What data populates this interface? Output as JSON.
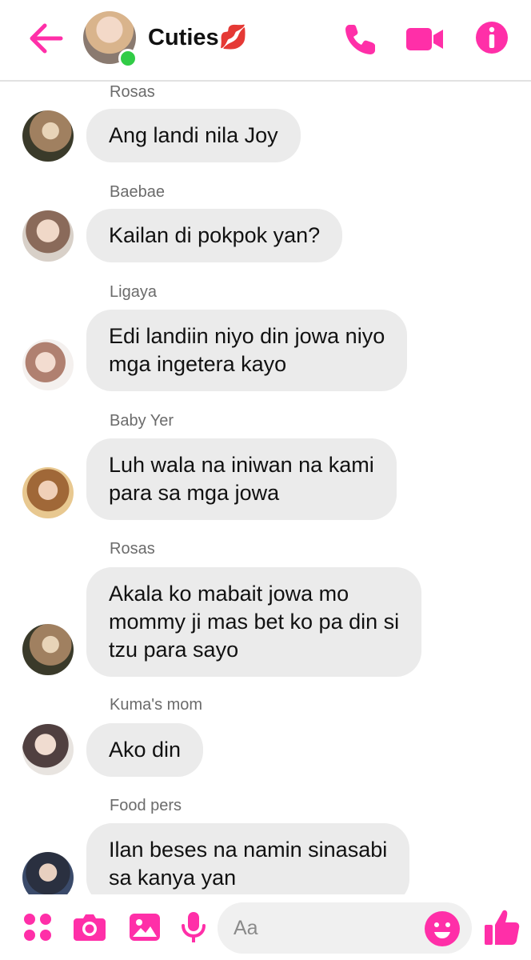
{
  "colors": {
    "accent": "#ff2fa8",
    "bubble": "#ebebeb",
    "online": "#31cc46",
    "sender_name": "#6b6b6b"
  },
  "header": {
    "title": "Cuties💋",
    "icons": [
      "back-arrow-icon",
      "phone-icon",
      "video-camera-icon",
      "info-icon"
    ]
  },
  "messages": [
    {
      "sender": "Rosas",
      "text": "Ang landi nila Joy"
    },
    {
      "sender": "Baebae",
      "text": "Kailan di pokpok yan?"
    },
    {
      "sender": "Ligaya",
      "text": "Edi landiin niyo din jowa niyo\nmga ingetera kayo"
    },
    {
      "sender": "Baby Yer",
      "text": "Luh wala na iniwan na kami\npara sa mga jowa"
    },
    {
      "sender": "Rosas",
      "text": "Akala ko mabait jowa mo\nmommy ji mas bet ko pa din si\ntzu para sayo"
    },
    {
      "sender": "Kuma's mom",
      "text": "Ako din"
    },
    {
      "sender": "Food pers",
      "text": "Ilan beses na namin sinasabi\nsa kanya yan"
    }
  ],
  "composer": {
    "placeholder": "Aa",
    "icons": [
      "apps-icon",
      "camera-icon",
      "gallery-icon",
      "microphone-icon",
      "emoji-icon",
      "thumbs-up-icon"
    ]
  }
}
